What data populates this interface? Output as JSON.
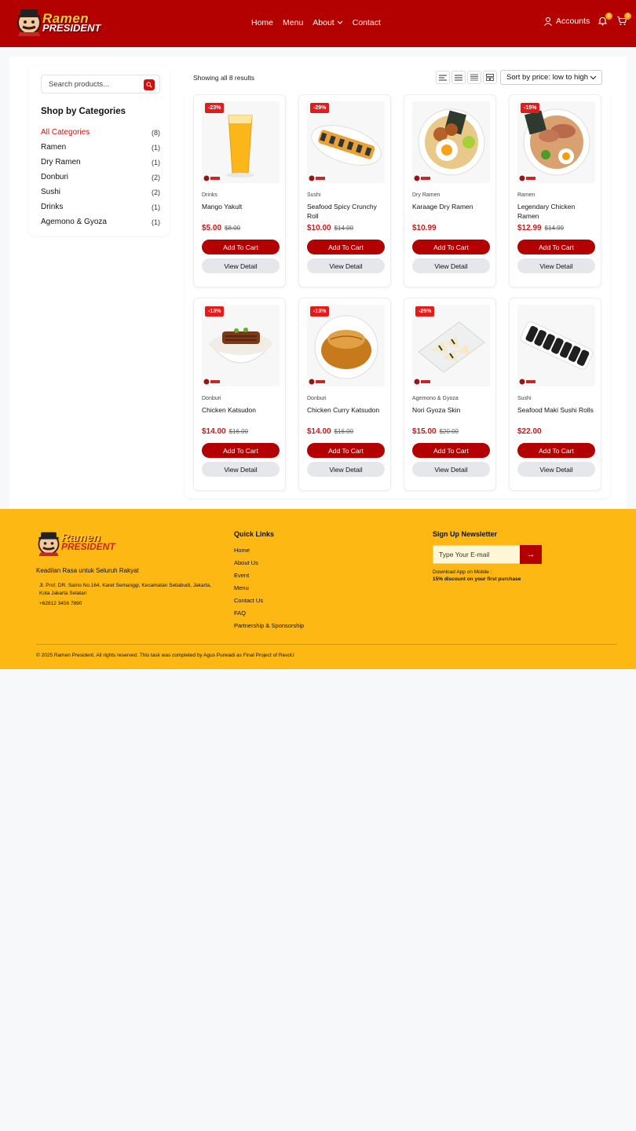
{
  "header": {
    "logo_line1": "Ramen",
    "logo_line2": "PRESIDENT",
    "nav": [
      "Home",
      "Menu",
      "About",
      "Contact"
    ],
    "accounts_label": "Accounts",
    "notification_count": "0",
    "cart_count": "0",
    "brand_color": "#b30000"
  },
  "search": {
    "placeholder": "Search products..."
  },
  "sidebar": {
    "title": "Shop by Categories",
    "categories": [
      {
        "name": "All Categories",
        "count": "(8)"
      },
      {
        "name": "Ramen",
        "count": "(1)"
      },
      {
        "name": "Dry Ramen",
        "count": "(1)"
      },
      {
        "name": "Donburi",
        "count": "(2)"
      },
      {
        "name": "Sushi",
        "count": "(2)"
      },
      {
        "name": "Drinks",
        "count": "(1)"
      },
      {
        "name": "Agemono & Gyoza",
        "count": "(1)"
      }
    ]
  },
  "toolbar": {
    "results": "Showing all 8 results",
    "sort": "Sort by price: low to high"
  },
  "buttons": {
    "add_to_cart": "Add To Cart",
    "view_detail": "View Detail"
  },
  "products": [
    {
      "discount": "-23%",
      "category": "Drinks",
      "name": "Mango Yakult",
      "price": "$5.00",
      "old_price": "$8.00",
      "image": "mango-yakult-icon"
    },
    {
      "discount": "-29%",
      "category": "Sushi",
      "name": "Seafood Spicy Crunchy Roll",
      "price": "$10.00",
      "old_price": "$14.00",
      "image": "sushi-roll-icon"
    },
    {
      "discount": "",
      "category": "Dry Ramen",
      "name": "Karaage Dry Ramen",
      "price": "$10.99",
      "old_price": "",
      "image": "dry-ramen-icon"
    },
    {
      "discount": "-15%",
      "category": "Ramen",
      "name": "Legendary Chicken Ramen",
      "price": "$12.99",
      "old_price": "$14.99",
      "image": "ramen-bowl-icon"
    },
    {
      "discount": "-13%",
      "category": "Donburi",
      "name": "Chicken Katsudon",
      "price": "$14.00",
      "old_price": "$16.00",
      "image": "katsudon-icon"
    },
    {
      "discount": "-13%",
      "category": "Donburi",
      "name": "Chicken Curry Katsudon",
      "price": "$14.00",
      "old_price": "$16.00",
      "image": "curry-katsudon-icon"
    },
    {
      "discount": "-25%",
      "category": "Agemono & Gyoza",
      "name": "Nori Gyoza Skin",
      "price": "$15.00",
      "old_price": "$20.00",
      "image": "gyoza-icon"
    },
    {
      "discount": "",
      "category": "Sushi",
      "name": "Seafood Maki Sushi Rolls",
      "price": "$22.00",
      "old_price": "",
      "image": "maki-roll-icon"
    }
  ],
  "footer": {
    "logo_line1": "Ramen",
    "logo_line2": "PRESIDENT",
    "tagline": "Keadilan Rasa untuk Seluruh Rakyat",
    "address": "Jl. Prof. DR. Satrio No.164, Karet Semanggi, Kecamatan Setiabudi, Jakarta, Kota Jakarta Selatan",
    "phone": "+62812 3456 7890",
    "quick_links_title": "Quick Links",
    "quick_links": [
      "Home",
      "About Us",
      "Event",
      "Menu",
      "Contact Us",
      "FAQ",
      "Partnership & Sponsorship"
    ],
    "newsletter_title": "Sign Up Newsletter",
    "email_placeholder": "Type Your E-mail",
    "submit_arrow": "→",
    "download_line1": "Download App on Mobile :",
    "download_line2": "15% discount on your first purchase",
    "copyright": "© 2025 Ramen President. All rights reserved. This task was completed by Agus Purwadi as Final Project of RevoU",
    "bg_color": "#fdb813"
  }
}
